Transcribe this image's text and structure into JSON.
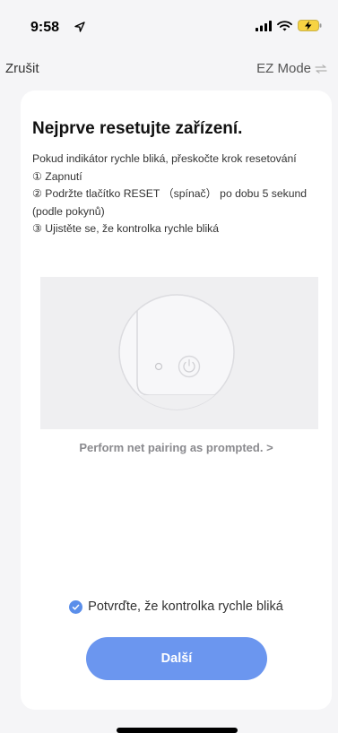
{
  "status_bar": {
    "time": "9:58"
  },
  "nav": {
    "cancel_label": "Zrušit",
    "mode_label": "EZ Mode"
  },
  "card": {
    "title": "Nejprve resetujte zařízení.",
    "instructions": [
      "Pokud indikátor rychle bliká, přeskočte krok resetování",
      "① Zapnutí",
      "② Podržte tlačítko RESET （spínač） po dobu 5 sekund (podle pokynů)",
      "③ Ujistěte se, že kontrolka rychle bliká"
    ],
    "pairing_link": "Perform net pairing as prompted. >",
    "confirm_label": "Potvrďte, že kontrolka rychle bliká",
    "confirm_checked": true,
    "next_label": "Další"
  },
  "colors": {
    "accent": "#6b96ef",
    "check": "#5a8eea",
    "card_bg": "#ffffff",
    "page_bg": "#f5f5f7"
  },
  "icons": [
    "location-arrow-icon",
    "signal-icon",
    "wifi-icon",
    "battery-charging-icon",
    "switch-mode-icon",
    "power-icon",
    "checkmark-icon"
  ]
}
